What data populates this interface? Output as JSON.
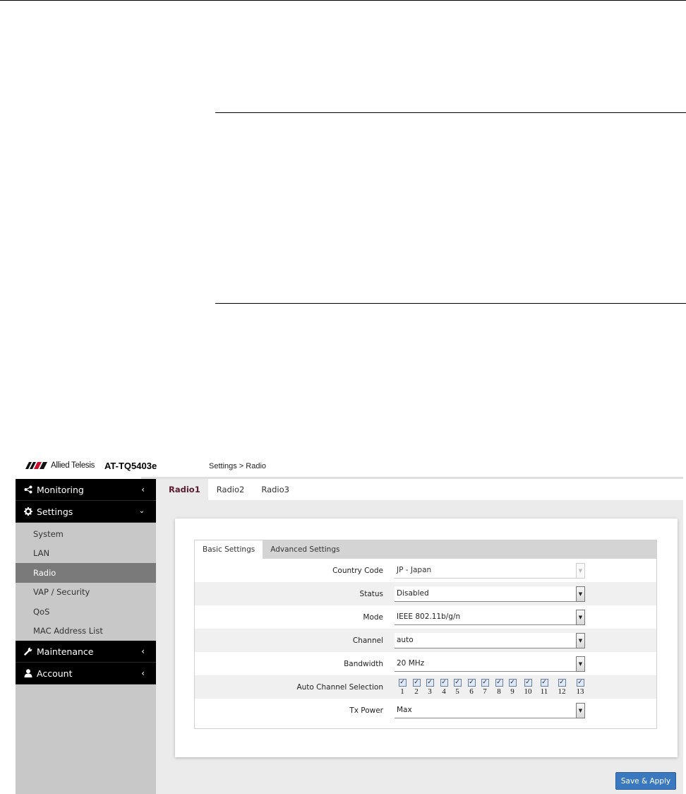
{
  "header": {
    "brand": "Allied Telesis",
    "model": "AT-TQ5403e",
    "breadcrumb": "Settings > Radio"
  },
  "sidebar": {
    "monitoring": {
      "label": "Monitoring",
      "icon": "share-icon"
    },
    "settings": {
      "label": "Settings",
      "icon": "gear-icon",
      "items": [
        {
          "label": "System"
        },
        {
          "label": "LAN"
        },
        {
          "label": "Radio",
          "active": true
        },
        {
          "label": "VAP / Security"
        },
        {
          "label": "QoS"
        },
        {
          "label": "MAC Address List"
        }
      ]
    },
    "maintenance": {
      "label": "Maintenance",
      "icon": "wrench-icon"
    },
    "account": {
      "label": "Account",
      "icon": "user-icon"
    }
  },
  "radio_tabs": [
    "Radio1",
    "Radio2",
    "Radio3"
  ],
  "sub_tabs": [
    "Basic Settings",
    "Advanced Settings"
  ],
  "form": {
    "country_code": {
      "label": "Country Code",
      "value": "JP - Japan"
    },
    "status": {
      "label": "Status",
      "value": "Disabled"
    },
    "mode": {
      "label": "Mode",
      "value": "IEEE 802.11b/g/n"
    },
    "channel": {
      "label": "Channel",
      "value": "auto"
    },
    "bandwidth": {
      "label": "Bandwidth",
      "value": "20 MHz"
    },
    "auto_channel": {
      "label": "Auto Channel Selection",
      "channels": [
        "1",
        "2",
        "3",
        "4",
        "5",
        "6",
        "7",
        "8",
        "9",
        "10",
        "11",
        "12",
        "13"
      ]
    },
    "tx_power": {
      "label": "Tx Power",
      "value": "Max"
    }
  },
  "save_label": "Save & Apply",
  "colors": {
    "accent": "#3a79c0",
    "sidebar_dark": "#000000",
    "active_item": "#7a7a7a"
  }
}
